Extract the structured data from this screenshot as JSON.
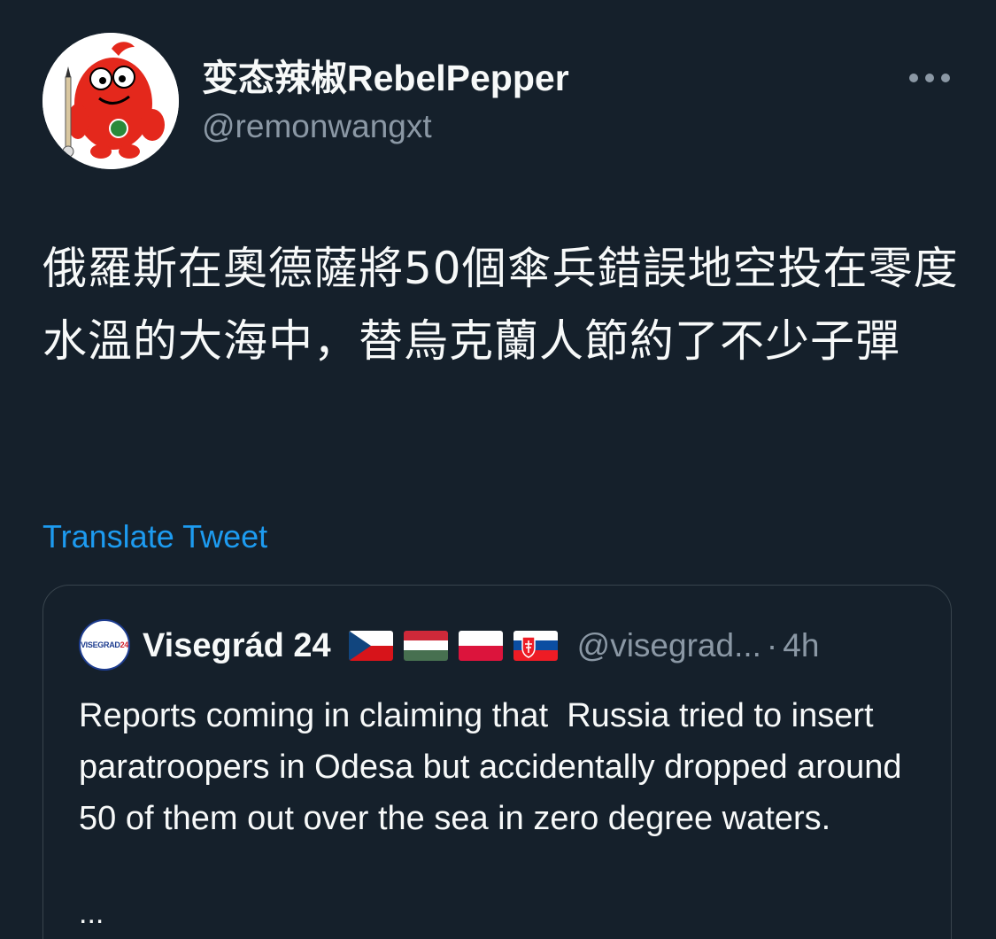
{
  "author": {
    "display_name": "变态辣椒RebelPepper",
    "handle": "@remonwangxt",
    "avatar_icon": "rebel-pepper-mascot-icon"
  },
  "more_icon": "ellipsis-icon",
  "tweet": {
    "text": "俄羅斯在奧德薩將50個傘兵錯誤地空投在零度水溫的大海中，替烏克蘭人節約了不少子彈"
  },
  "translate_label": "Translate Tweet",
  "quoted_tweet": {
    "avatar_text_a": "VISEGRAD",
    "avatar_text_b": "24",
    "display_name": "Visegrád 24",
    "flags": [
      "czech-flag",
      "hungary-flag",
      "poland-flag",
      "slovakia-flag"
    ],
    "handle": "@visegrad...",
    "separator": "·",
    "time": "4h",
    "text": "Reports coming in claiming that  Russia tried to insert paratroopers in Odesa but accidentally dropped around 50 of them out over the sea in zero degree waters.",
    "ellipsis": "..."
  },
  "colors": {
    "background": "#15202b",
    "link": "#1d9bf0",
    "secondary_text": "#8b98a5",
    "border": "#38444d"
  }
}
